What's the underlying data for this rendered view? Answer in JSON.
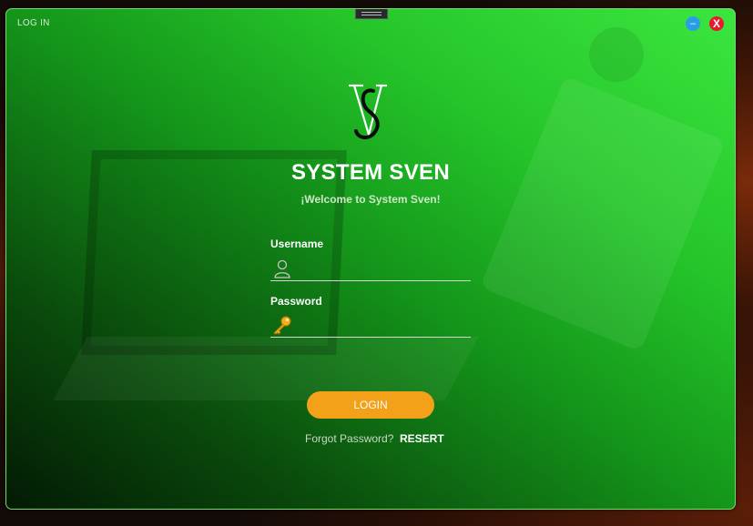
{
  "window": {
    "title": "LOG IN",
    "minimize_label": "–",
    "close_label": "X"
  },
  "brand": {
    "logo_icon": "vs-monogram-logo",
    "app_title": "SYSTEM SVEN",
    "welcome": "¡Welcome to System Sven!"
  },
  "form": {
    "username_label": "Username",
    "username_value": "",
    "username_icon": "user-icon",
    "password_label": "Password",
    "password_value": "",
    "password_icon": "key-icon",
    "login_label": "LOGIN",
    "forgot_label": "Forgot Password?",
    "reset_label": "RESERT"
  },
  "colors": {
    "login_button": "#f4a11a",
    "close_button": "#e8192c",
    "minimize_button": "#2b9de8",
    "window_gradient_dark": "#031a04",
    "window_gradient_light": "#3be63f"
  }
}
